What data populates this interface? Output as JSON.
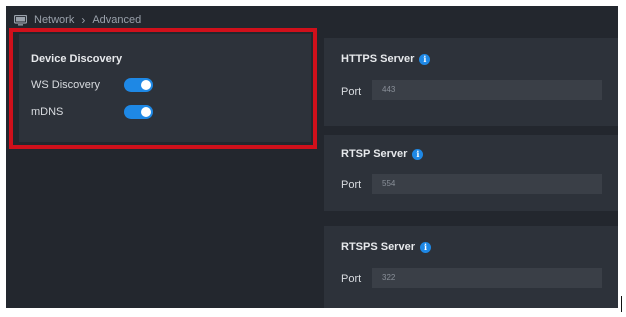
{
  "breadcrumb": {
    "root": "Network",
    "separator": "›",
    "current": "Advanced"
  },
  "device_discovery": {
    "title": "Device Discovery",
    "items": [
      {
        "label": "WS Discovery",
        "enabled": true
      },
      {
        "label": "mDNS",
        "enabled": true
      }
    ]
  },
  "servers": [
    {
      "title": "HTTPS Server",
      "port_label": "Port",
      "port_value": "443"
    },
    {
      "title": "RTSP Server",
      "port_label": "Port",
      "port_value": "554"
    },
    {
      "title": "RTSPS Server",
      "port_label": "Port",
      "port_value": "322"
    }
  ],
  "icons": {
    "breadcrumb": "monitor-icon",
    "server_info": "info-icon"
  },
  "colors": {
    "background": "#23272e",
    "panel": "#2d323a",
    "accent": "#1e88e5",
    "highlight": "#d0101b"
  }
}
